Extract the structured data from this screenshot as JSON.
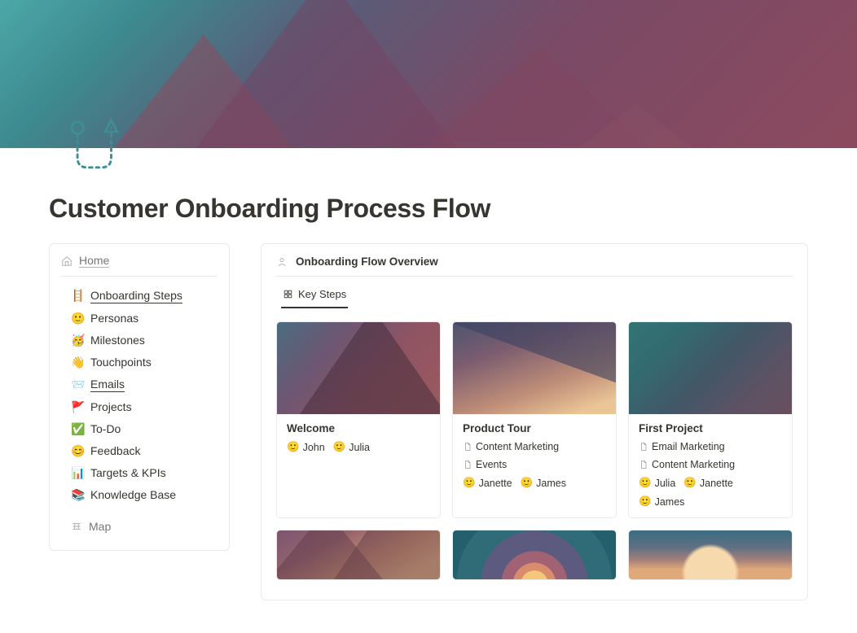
{
  "page": {
    "title": "Customer Onboarding Process Flow"
  },
  "sidebar": {
    "home": "Home",
    "items": [
      {
        "emoji": "🪜",
        "label": "Onboarding Steps",
        "underlined": true
      },
      {
        "emoji": "🙂",
        "label": "Personas"
      },
      {
        "emoji": "🥳",
        "label": "Milestones"
      },
      {
        "emoji": "👋",
        "label": "Touchpoints"
      },
      {
        "emoji": "📨",
        "label": "Emails",
        "underlined": true
      },
      {
        "emoji": "🚩",
        "label": "Projects"
      },
      {
        "emoji": "✅",
        "label": "To-Do"
      },
      {
        "emoji": "😊",
        "label": "Feedback"
      },
      {
        "emoji": "📊",
        "label": "Targets & KPIs"
      },
      {
        "emoji": "📚",
        "label": "Knowledge Base"
      }
    ],
    "map": "Map"
  },
  "overview": {
    "title": "Onboarding Flow Overview",
    "tab": "Key Steps"
  },
  "cards": [
    {
      "title": "Welcome",
      "personas": [
        "John",
        "Julia"
      ],
      "pages": []
    },
    {
      "title": "Product Tour",
      "personas": [
        "Janette",
        "James"
      ],
      "pages": [
        "Content Marketing",
        "Events"
      ]
    },
    {
      "title": "First Project",
      "personas": [
        "Julia",
        "Janette",
        "James"
      ],
      "pages": [
        "Email Marketing",
        "Content Marketing"
      ]
    }
  ]
}
